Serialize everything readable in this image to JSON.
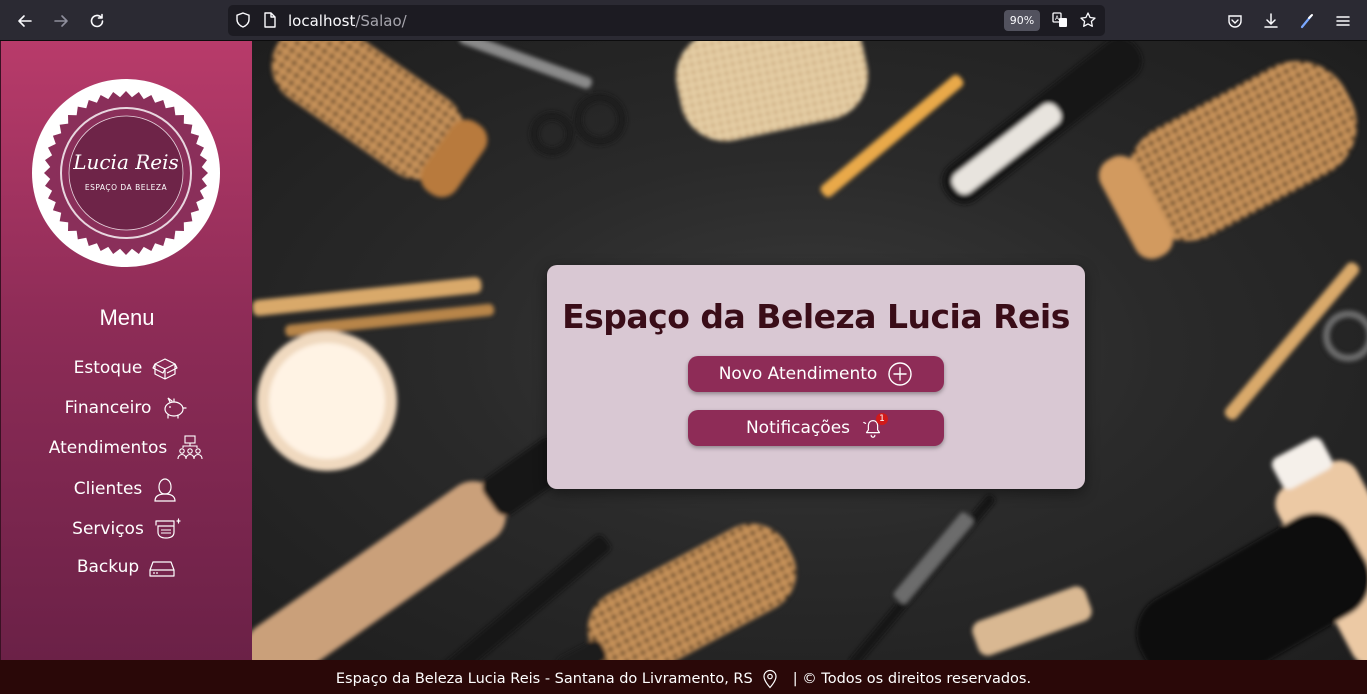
{
  "browser": {
    "url_host": "localhost",
    "url_path": "/Salao/",
    "zoom": "90%",
    "icons": [
      "back-icon",
      "forward-icon",
      "reload-icon",
      "shield-icon",
      "page-icon",
      "translate-icon",
      "bookmark-star-icon",
      "pocket-icon",
      "download-icon",
      "extension-icon",
      "hamburger-menu-icon"
    ]
  },
  "sidebar": {
    "logo": {
      "name": "Lucia Reis",
      "tagline": "ESPAÇO DA BELEZA"
    },
    "menu_title": "Menu",
    "items": [
      {
        "label": "Estoque",
        "icon": "box-icon"
      },
      {
        "label": "Financeiro",
        "icon": "piggy-bank-icon"
      },
      {
        "label": "Atendimentos",
        "icon": "people-icon"
      },
      {
        "label": "Clientes",
        "icon": "user-icon"
      },
      {
        "label": "Serviços",
        "icon": "service-icon"
      },
      {
        "label": "Backup",
        "icon": "drive-icon"
      }
    ]
  },
  "card": {
    "title": "Espaço da Beleza Lucia Reis",
    "buttons": [
      {
        "label": "Novo Atendimento",
        "icon": "plus-circle-icon"
      },
      {
        "label": "Notificações",
        "icon": "bell-icon",
        "badge": "1"
      }
    ]
  },
  "footer": {
    "left": "Espaço da Beleza Lucia Reis - Santana do Livramento, RS",
    "right": "| © Todos os direitos reservados."
  },
  "colors": {
    "sidebar_top": "#b83b6a",
    "sidebar_bottom": "#6b2147",
    "button": "#8e2c57",
    "card": "#d9c8d3",
    "title": "#3a0d18",
    "footer": "#2a0808"
  }
}
